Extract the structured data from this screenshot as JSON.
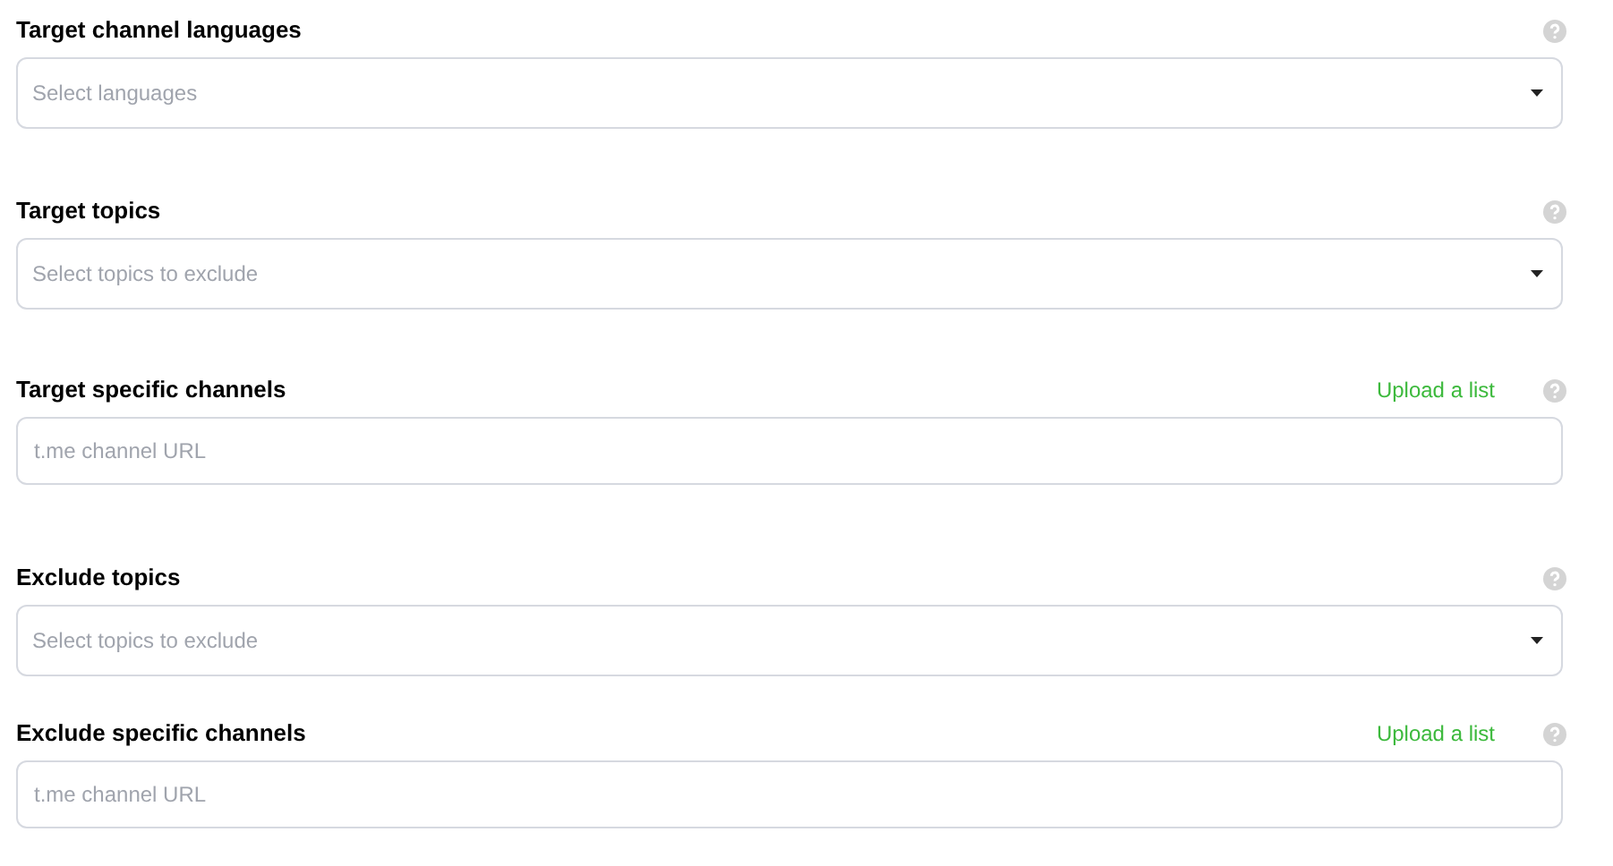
{
  "sections": [
    {
      "label": "Target channel languages",
      "kind": "dropdown",
      "placeholder": "Select languages"
    },
    {
      "label": "Target topics",
      "kind": "dropdown",
      "placeholder": "Select topics to exclude"
    },
    {
      "label": "Target specific channels",
      "kind": "text",
      "placeholder": "t.me channel URL",
      "link": "Upload a list"
    },
    {
      "label": "Exclude topics",
      "kind": "dropdown",
      "placeholder": "Select topics to exclude"
    },
    {
      "label": "Exclude specific channels",
      "kind": "text",
      "placeholder": "t.me channel URL",
      "link": "Upload a list"
    }
  ]
}
